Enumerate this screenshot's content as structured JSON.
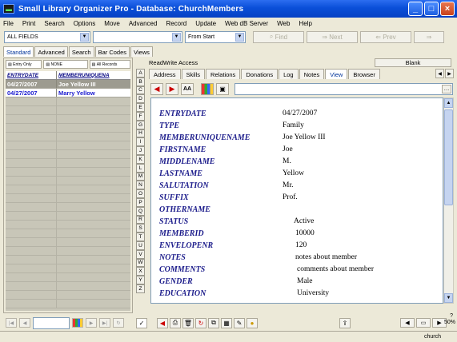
{
  "window": {
    "title": "Small Library Organizer Pro  -  Database: ChurchMembers",
    "minimize_label": "_",
    "maximize_label": "□",
    "close_label": "×"
  },
  "menu": [
    "File",
    "Print",
    "Search",
    "Options",
    "Move",
    "Advanced",
    "Record",
    "Update",
    "Web dB Server",
    "Web",
    "Help"
  ],
  "toolbar": {
    "field_combo": "ALL FIELDS",
    "search_combo": "",
    "start_combo": "From Start",
    "find_label": "Find",
    "next_label": "Next",
    "prev_label": "Prev"
  },
  "left_tabs": [
    "Standard",
    "Advanced",
    "Search",
    "Bar Codes",
    "Views"
  ],
  "left_buttons": [
    "Entry Only",
    "NONE",
    "All Records"
  ],
  "grid": {
    "headers": [
      "ENTRYDATE",
      "MEMBERUNIQUENA"
    ],
    "rows": [
      {
        "date": "04/27/2007",
        "name": "Joe Yellow III",
        "selected": true
      },
      {
        "date": "04/27/2007",
        "name": "Marry Yellow",
        "selected": false
      }
    ]
  },
  "alphabet": [
    "A",
    "B",
    "C",
    "D",
    "E",
    "F",
    "G",
    "H",
    "I",
    "J",
    "K",
    "L",
    "M",
    "N",
    "O",
    "P",
    "Q",
    "R",
    "S",
    "T",
    "U",
    "V",
    "W",
    "X",
    "Y",
    "Z"
  ],
  "readwrite_label": "ReadWrite Access",
  "blank_label": "Blank",
  "detail_tabs": [
    "Address",
    "Skills",
    "Relations",
    "Donations",
    "Log",
    "Notes",
    "View",
    "Browser"
  ],
  "fields": [
    {
      "label": "ENTRYDATE",
      "value": "04/27/2007"
    },
    {
      "label": "TYPE",
      "value": "Family"
    },
    {
      "label": "MEMBERUNIQUENAME",
      "value": "Joe Yellow III"
    },
    {
      "label": "FIRSTNAME",
      "value": "Joe"
    },
    {
      "label": "MIDDLENAME",
      "value": "M."
    },
    {
      "label": "LASTNAME",
      "value": "Yellow"
    },
    {
      "label": "SALUTATION",
      "value": "Mr."
    },
    {
      "label": "SUFFIX",
      "value": "Prof."
    },
    {
      "label": "OTHERNAME",
      "value": ""
    },
    {
      "label": "STATUS",
      "value": "Active"
    },
    {
      "label": "MEMBERID",
      "value": "10000"
    },
    {
      "label": "ENVELOPENR",
      "value": "120"
    },
    {
      "label": "NOTES",
      "value": "notes about member"
    },
    {
      "label": "COMMENTS",
      "value": "comments about member"
    },
    {
      "label": "GENDER",
      "value": "Male"
    },
    {
      "label": "EDUCATION",
      "value": "University"
    }
  ],
  "status": {
    "database": "church",
    "zoom": "50%",
    "help": "?"
  }
}
